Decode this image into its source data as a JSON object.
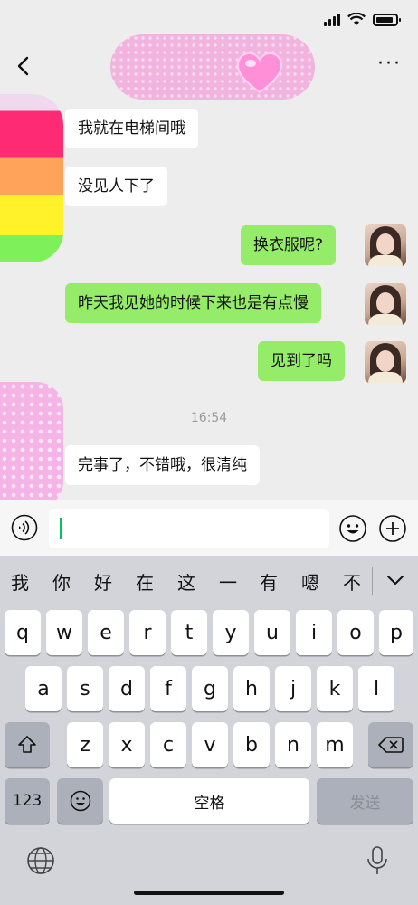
{
  "status_bar": {
    "signal_icon": "cellular-signal-icon",
    "wifi_icon": "wifi-icon",
    "battery_icon": "battery-icon"
  },
  "header": {
    "back_icon": "chevron-left-icon",
    "more_label": "···"
  },
  "messages": [
    {
      "side": "left",
      "text": "我就在电梯间哦"
    },
    {
      "side": "left",
      "text": "没见人下了"
    },
    {
      "side": "right",
      "text": "换衣服呢?"
    },
    {
      "side": "right",
      "text": "昨天我见她的时候下来也是有点慢"
    },
    {
      "side": "right",
      "text": "见到了吗"
    },
    {
      "side": "left",
      "text": "完事了，不错哦，很清纯"
    }
  ],
  "timestamp": "16:54",
  "input_bar": {
    "voice_icon": "voice-icon",
    "emoji_icon": "emoji-icon",
    "plus_icon": "plus-icon",
    "value": ""
  },
  "keyboard": {
    "candidates": [
      "我",
      "你",
      "好",
      "在",
      "这",
      "一",
      "有",
      "嗯",
      "不"
    ],
    "row1": [
      "q",
      "w",
      "e",
      "r",
      "t",
      "y",
      "u",
      "i",
      "o",
      "p"
    ],
    "row2": [
      "a",
      "s",
      "d",
      "f",
      "g",
      "h",
      "j",
      "k",
      "l"
    ],
    "row3": [
      "z",
      "x",
      "c",
      "v",
      "b",
      "n",
      "m"
    ],
    "numbers_label": "123",
    "space_label": "空格",
    "send_label": "发送"
  },
  "colors": {
    "background": "#ededed",
    "bubble_right": "#95ec69",
    "bubble_left": "#ffffff",
    "caret": "#07c160"
  }
}
